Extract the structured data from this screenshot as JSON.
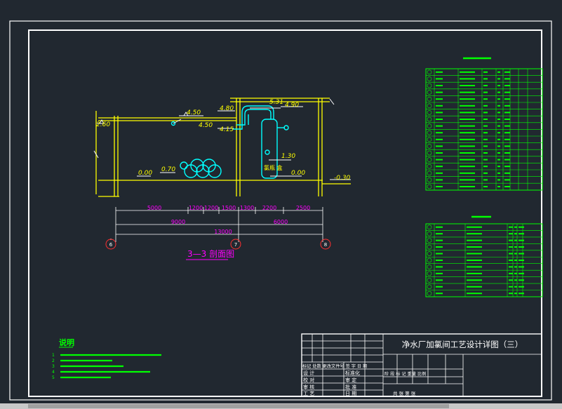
{
  "drawing": {
    "section_title": "3—3 剖面图",
    "tank_label": "氯瓶 盒",
    "elevations": {
      "e260": "2.60",
      "e450": "4.50",
      "e480": "4.80",
      "e415": "4.15",
      "e531": "5.31",
      "e490": "4.90",
      "e450b": "4.50",
      "e130": "1.30",
      "e000a": "0.00",
      "e070": "0.70",
      "e000b": "0.00",
      "em030": "-0.30"
    },
    "dimensions": {
      "d5000": "5000",
      "d1200a": "1200",
      "d1200b": "1200",
      "d1500": "1500",
      "d1300": "1300",
      "d2200": "2200",
      "d2500": "2500",
      "d9000": "9000",
      "d6000": "6000",
      "d13000": "13000"
    },
    "axes": {
      "a6": "6",
      "a7": "7",
      "a8": "8"
    }
  },
  "notes": {
    "title": "说明",
    "numbers": [
      "1",
      "2",
      "3",
      "4",
      "5"
    ]
  },
  "title_block": {
    "drawing_title": "净水厂加氯间工艺设计详图（三）",
    "left_rows": [
      [
        "设 计",
        "标准化"
      ],
      [
        "校 对",
        "审 定"
      ],
      [
        "审 核",
        "批 准"
      ],
      [
        "工 艺",
        "日 期"
      ]
    ],
    "left_header": "标记 处数 更改文件号 签 字 日 期",
    "mid_row": "阶 段 标 记  重量  比例",
    "bottom_row": "共 张    第 张"
  },
  "colors": {
    "background": "#212830",
    "frame": "#ffffff",
    "wall": "#ffff00",
    "pipe": "#00ffff",
    "dim": "#ff00ff",
    "table": "#00ff00",
    "red": "#ff3030"
  }
}
